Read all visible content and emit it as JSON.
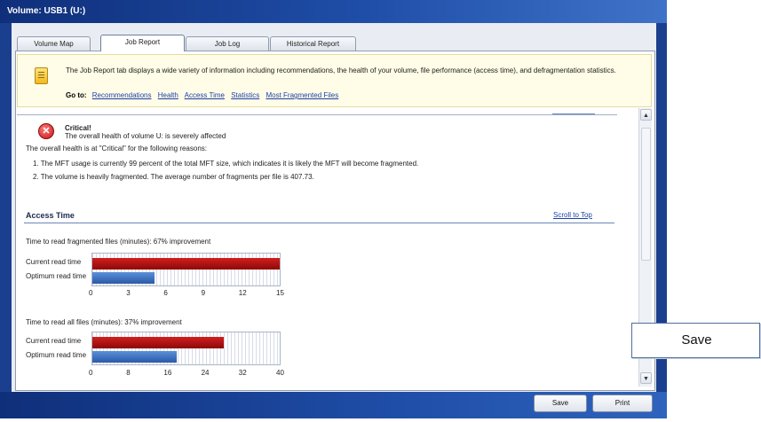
{
  "window": {
    "title": "Volume: USB1 (U:)"
  },
  "tabs": [
    {
      "label": "Volume Map"
    },
    {
      "label": "Job Report",
      "active": true
    },
    {
      "label": "Job Log"
    },
    {
      "label": "Historical Report"
    }
  ],
  "info": {
    "icon": "report-icon",
    "text": "The Job Report tab displays a wide variety of information including recommendations, the health of your volume, file performance (access time), and defragmentation statistics.",
    "goto_label": "Go to:",
    "links": [
      "Recommendations",
      "Health",
      "Access Time",
      "Statistics",
      "Most Fragmented Files"
    ]
  },
  "health": {
    "icon": "critical-error-icon",
    "icon_glyph": "✕",
    "status": "Critical!",
    "description": "The overall health of volume U: is severely affected",
    "reason_intro": "The overall health is at \"Critical\" for the following reasons:",
    "reasons": [
      "1. The MFT usage is currently 99 percent of the total MFT size, which indicates it is likely the MFT will become fragmented.",
      "2. The volume is heavily fragmented. The average number of fragments per file is 407.73."
    ]
  },
  "access_time": {
    "title": "Access Time",
    "scroll_to_top": "Scroll to Top",
    "charts": [
      {
        "caption": "Time to read fragmented files (minutes): 67% improvement",
        "series_labels": [
          "Current read time",
          "Optimum read time"
        ],
        "ticks": [
          "0",
          "3",
          "6",
          "9",
          "12",
          "15"
        ],
        "chart_data": {
          "type": "bar",
          "categories": [
            "Current read time",
            "Optimum read time"
          ],
          "values": [
            15,
            5
          ],
          "xlim": [
            0,
            15
          ]
        }
      },
      {
        "caption": "Time to read all files (minutes): 37% improvement",
        "series_labels": [
          "Current read time",
          "Optimum read time"
        ],
        "ticks": [
          "0",
          "8",
          "16",
          "24",
          "32",
          "40"
        ],
        "chart_data": {
          "type": "bar",
          "categories": [
            "Current read time",
            "Optimum read time"
          ],
          "values": [
            28,
            18
          ],
          "xlim": [
            0,
            40
          ]
        }
      }
    ],
    "colors": {
      "current": "#b11414",
      "optimum": "#3a6fc0"
    }
  },
  "scrollbar": {
    "up": "▲",
    "down": "▼"
  },
  "buttons": {
    "save": "Save",
    "print": "Print"
  },
  "callout": {
    "label": "Save"
  }
}
